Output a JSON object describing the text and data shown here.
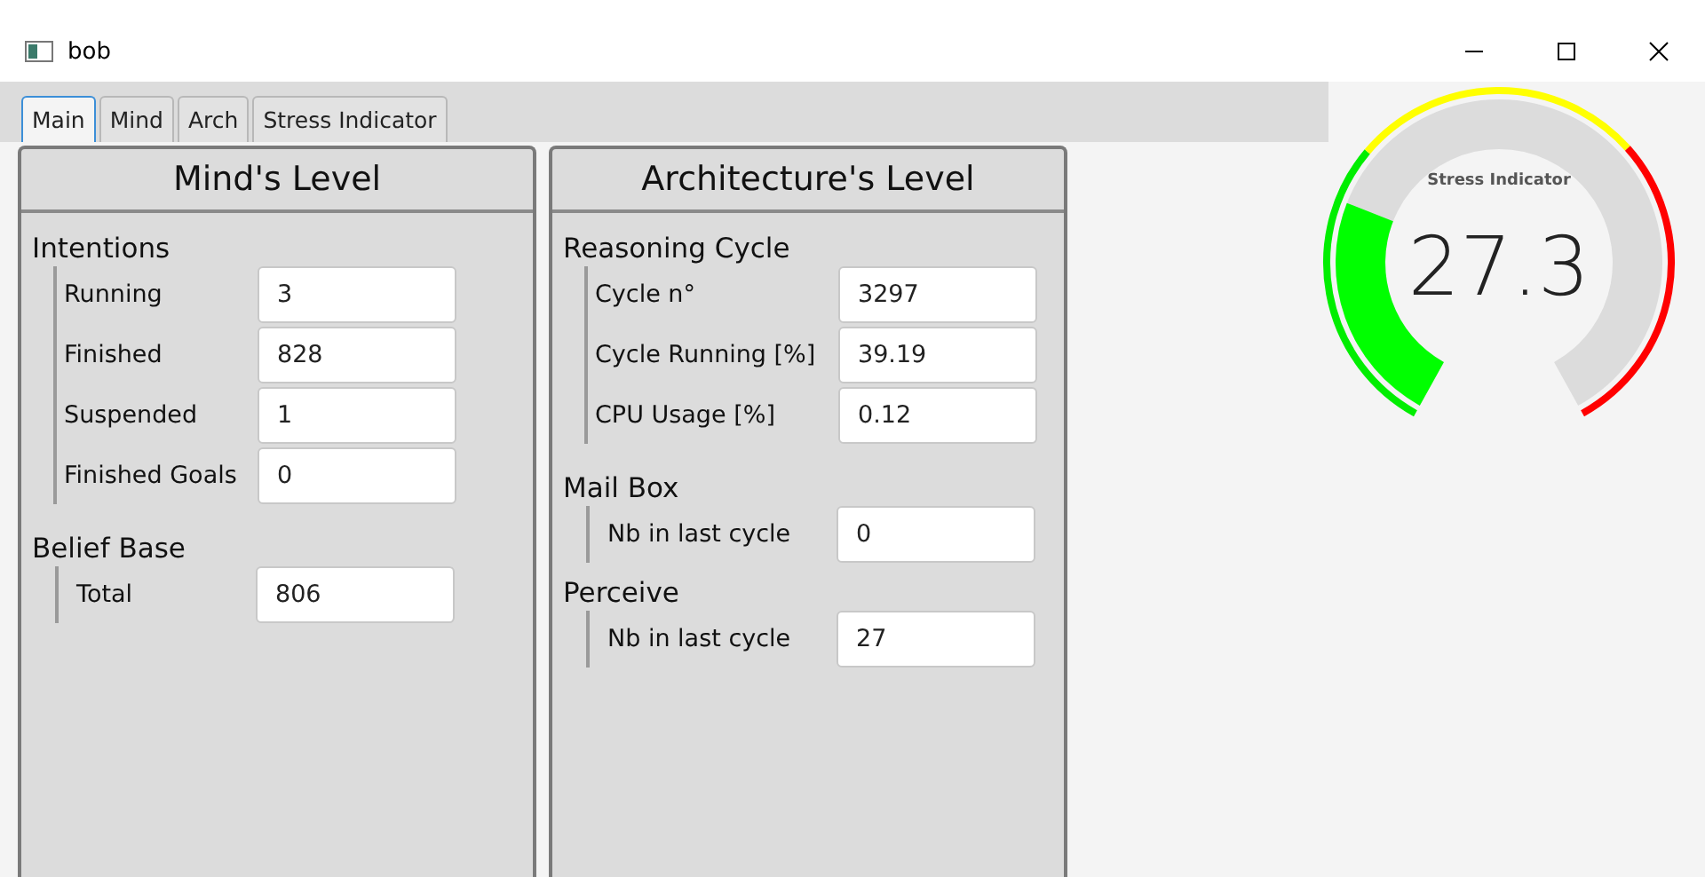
{
  "window": {
    "title": "bob"
  },
  "tabs": [
    {
      "label": "Main",
      "selected": true
    },
    {
      "label": "Mind",
      "selected": false
    },
    {
      "label": "Arch",
      "selected": false
    },
    {
      "label": "Stress Indicator",
      "selected": false
    }
  ],
  "panels": [
    {
      "title": "Mind's Level",
      "sections": [
        {
          "title": "Intentions",
          "rows": [
            {
              "label": "Running",
              "value": "3"
            },
            {
              "label": "Finished",
              "value": "828"
            },
            {
              "label": "Suspended",
              "value": "1"
            },
            {
              "label": "Finished Goals",
              "value": "0"
            }
          ]
        },
        {
          "title": "Belief Base",
          "rows": [
            {
              "label": "Total",
              "value": "806"
            }
          ]
        }
      ]
    },
    {
      "title": "Architecture's Level",
      "sections": [
        {
          "title": "Reasoning Cycle",
          "rows": [
            {
              "label": "Cycle n°",
              "value": "3297"
            },
            {
              "label": "Cycle Running [%]",
              "value": "39.19"
            },
            {
              "label": "CPU Usage [%]",
              "value": "0.12"
            }
          ]
        },
        {
          "title": "Mail Box",
          "rows": [
            {
              "label": "Nb in last cycle",
              "value": "0"
            }
          ]
        },
        {
          "title": "Perceive",
          "rows": [
            {
              "label": "Nb in last cycle",
              "value": "27"
            }
          ]
        }
      ]
    }
  ],
  "gauge": {
    "title": "Stress Indicator",
    "reading": "27.3"
  }
}
